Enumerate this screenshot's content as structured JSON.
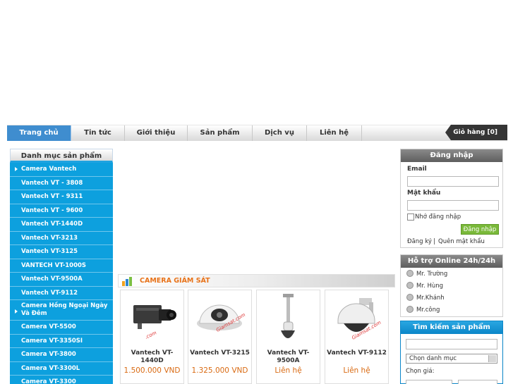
{
  "nav": {
    "items": [
      "Trang chủ",
      "Tin tức",
      "Giới thiệu",
      "Sản phẩm",
      "Dịch vụ",
      "Liên hệ"
    ],
    "cart": "Giỏ hàng [0]"
  },
  "categories": {
    "title": "Danh mục sản phẩm",
    "items": [
      "Camera Vantech",
      "Vantech VT - 3808",
      "Vantech VT - 9311",
      "Vantech VT - 9600",
      "Vantech VT-1440D",
      "Vantech VT-3213",
      "Vantech VT-3125",
      "VANTECH VT-1000S",
      "Vantech VT-9500A",
      "Vantech VT-9112",
      "Camera Hồng Ngoại Ngày Và Đêm",
      "Camera VT-5500",
      "Camera VT-3350SI",
      "Camera VT-3800",
      "Camera VT-3300L",
      "Camera VT-3300"
    ]
  },
  "products": {
    "section_title": "CAMERA GIÁM SÁT",
    "items": [
      {
        "name": "Vantech VT-1440D",
        "price": "1.500.000 VND"
      },
      {
        "name": "Vantech VT-3215",
        "price": "1.325.000 VND"
      },
      {
        "name": "Vantech VT-9500A",
        "price": "Liên hệ"
      },
      {
        "name": "Vantech VT-9112",
        "price": "Liên hệ"
      }
    ]
  },
  "login": {
    "title": "Đăng nhập",
    "email_label": "Email",
    "password_label": "Mật khẩu",
    "remember": "Nhớ đăng nhập",
    "button": "Đăng nhập",
    "register": "Đăng ký",
    "separator": "|",
    "forgot": "Quên mật khẩu"
  },
  "support": {
    "title": "Hỗ trợ Online 24h/24h",
    "contacts": [
      "Mr. Trường",
      "Mr. Hùng",
      "Mr.Khánh",
      "Mr.công"
    ]
  },
  "search": {
    "title": "Tìm kiếm sản phẩm",
    "category_select": "Chọn danh mục",
    "price_label": "Chọn giá:"
  },
  "colors": {
    "accent_blue": "#0da0de",
    "nav_active": "#3f8dcf",
    "price_orange": "#d96a12",
    "login_button": "#7ab93a"
  }
}
